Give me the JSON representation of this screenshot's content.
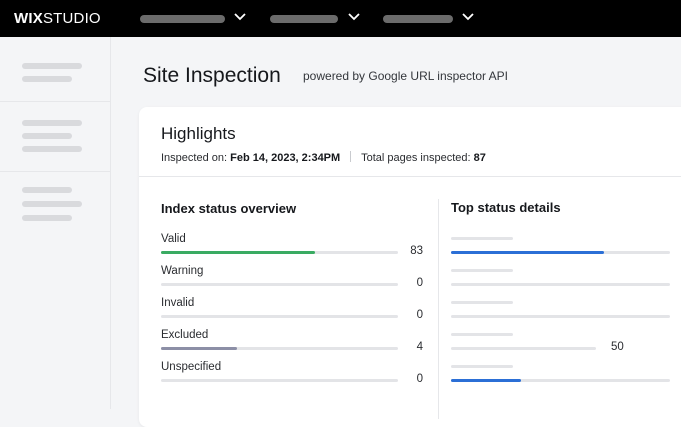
{
  "header": {
    "logo_bold": "WIX",
    "logo_rest": "STUDIO",
    "nav": [
      {
        "icon": "chevron-down-icon"
      },
      {
        "icon": "chevron-down-icon"
      },
      {
        "icon": "chevron-down-icon"
      }
    ]
  },
  "page": {
    "title": "Site Inspection",
    "subtitle": "powered by Google URL inspector API"
  },
  "highlights": {
    "title": "Highlights",
    "inspected_label": "Inspected on:",
    "inspected_value": "Feb 14, 2023, 2:34PM",
    "total_label": "Total pages inspected:",
    "total_value": "87"
  },
  "index_status": {
    "title": "Index status overview",
    "rows": [
      {
        "label": "Valid",
        "value": "83",
        "fraction": 0.65,
        "color": "#3aab62"
      },
      {
        "label": "Warning",
        "value": "0",
        "fraction": 0,
        "color": "#e3e4e7"
      },
      {
        "label": "Invalid",
        "value": "0",
        "fraction": 0,
        "color": "#e3e4e7"
      },
      {
        "label": "Excluded",
        "value": "4",
        "fraction": 0.32,
        "color": "#8c8fa6"
      },
      {
        "label": "Unspecified",
        "value": "0",
        "fraction": 0,
        "color": "#e3e4e7"
      }
    ]
  },
  "top_status": {
    "title": "Top status details",
    "rows": [
      {
        "value": "",
        "fraction": 0.7,
        "color": "#2b6fd6"
      },
      {
        "value": "",
        "fraction": 0,
        "color": "#e3e4e7"
      },
      {
        "value": "",
        "fraction": 0,
        "color": "#e3e4e7"
      },
      {
        "value": "50",
        "fraction": 0,
        "color": "#e3e4e7"
      },
      {
        "value": "",
        "fraction": 0.32,
        "color": "#2b6fd6"
      }
    ]
  }
}
